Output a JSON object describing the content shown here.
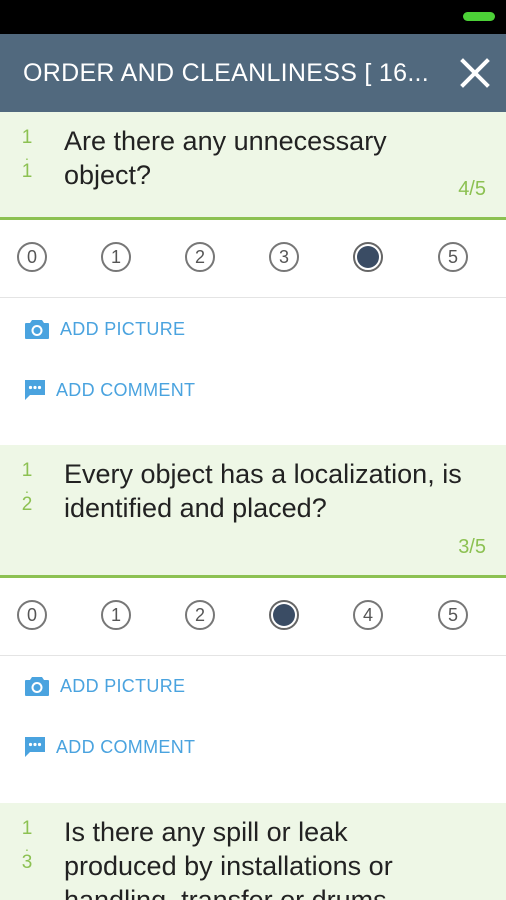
{
  "header": {
    "title": "ORDER AND CLEANLINESS [ 16...",
    "close_icon": "close-icon"
  },
  "colors": {
    "app_bar": "#51697e",
    "accent_green": "#8cc152",
    "question_bg": "#eef7e6",
    "link_blue": "#4aa3df",
    "selected_dot": "#3a4c64"
  },
  "questions": [
    {
      "num_major": "1",
      "num_dot": ".",
      "num_minor": "1",
      "text": "Are there any unnecessary object?",
      "score": "4/5",
      "options": [
        "0",
        "1",
        "2",
        "3",
        "4",
        "5"
      ],
      "selected": "4",
      "add_picture_label": "ADD PICTURE",
      "add_comment_label": "ADD COMMENT"
    },
    {
      "num_major": "1",
      "num_dot": ".",
      "num_minor": "2",
      "text": "Every object has a localization, is identified and placed?",
      "score": "3/5",
      "options": [
        "0",
        "1",
        "2",
        "3",
        "4",
        "5"
      ],
      "selected": "3",
      "add_picture_label": "ADD PICTURE",
      "add_comment_label": "ADD COMMENT"
    },
    {
      "num_major": "1",
      "num_dot": ".",
      "num_minor": "3",
      "text": "Is there any spill or leak produced by installations or handling, transfer or drums..."
    }
  ]
}
